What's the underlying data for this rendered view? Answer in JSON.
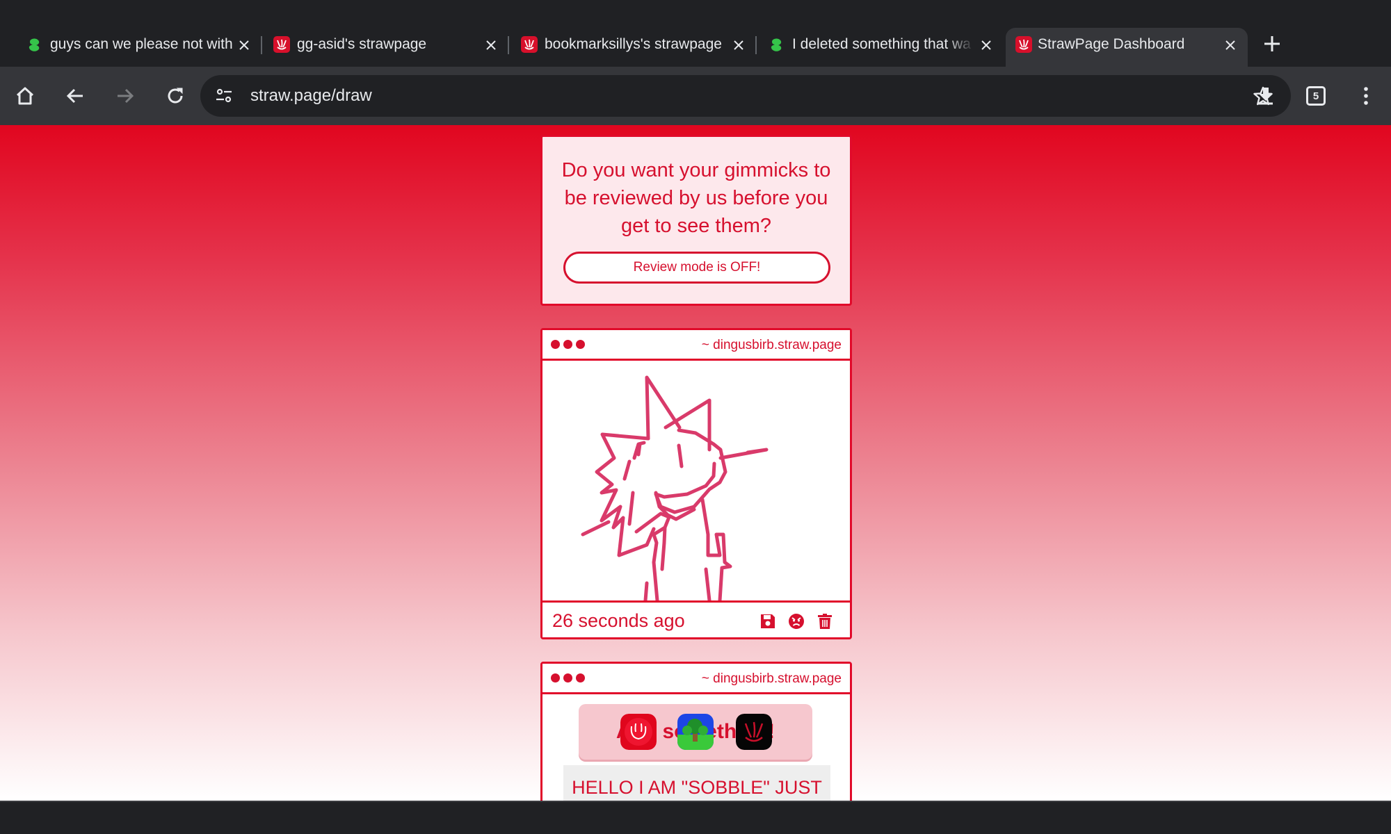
{
  "tabs": [
    {
      "title": "guys can we please not with",
      "favicon": "green-blob-icon"
    },
    {
      "title": "gg-asid's strawpage",
      "favicon": "strawpage-icon"
    },
    {
      "title": "bookmarksillys's strawpage",
      "favicon": "strawpage-icon"
    },
    {
      "title": "I deleted something that wa",
      "favicon": "green-blob-icon"
    },
    {
      "title": "StrawPage Dashboard",
      "favicon": "strawpage-icon",
      "active": true
    }
  ],
  "toolbar": {
    "url": "straw.page/draw",
    "tab_count": "5"
  },
  "review": {
    "question": "Do you want your gimmicks to be reviewed by us before you get to see them?",
    "toggle_label": "Review mode is OFF!"
  },
  "posts": [
    {
      "author": "~ dingusbirb.straw.page",
      "time": "26 seconds ago",
      "content": "drawing"
    },
    {
      "author": "~ dingusbirb.straw.page",
      "banner": "Add something!",
      "note": "HELLO I AM \"SOBBLE\" JUST KIDDING I AM NOT A"
    }
  ],
  "colors": {
    "accent": "#d6102e",
    "border": "#e10a2a",
    "chrome_dark": "#202124",
    "chrome_toolbar": "#35363a"
  }
}
